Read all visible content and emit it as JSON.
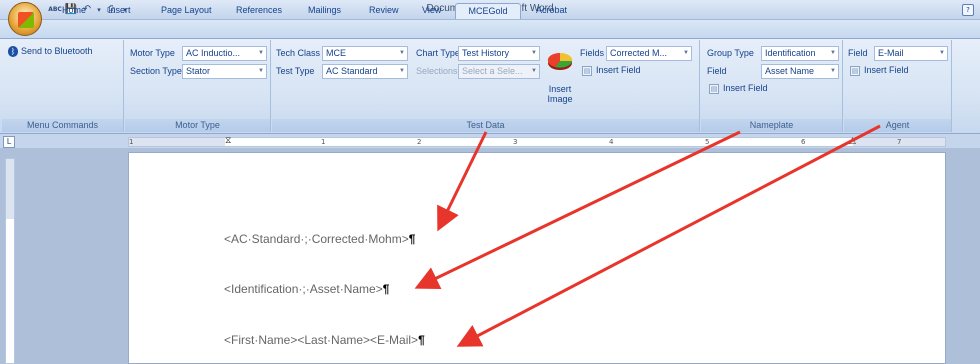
{
  "titlebar": {
    "title": "Document2 - Microsoft Word",
    "help": "?"
  },
  "qat": {
    "spell": "ABC",
    "save": "💾",
    "undo": "↶",
    "dropdown": "▾",
    "print": "⎙"
  },
  "tabs": [
    {
      "label": "Home"
    },
    {
      "label": "Insert"
    },
    {
      "label": "Page Layout"
    },
    {
      "label": "References"
    },
    {
      "label": "Mailings"
    },
    {
      "label": "Review"
    },
    {
      "label": "View"
    },
    {
      "label": "MCEGold"
    },
    {
      "label": "Acrobat"
    }
  ],
  "ribbon": {
    "menu_commands": {
      "send_bluetooth": "Send to Bluetooth",
      "label": "Menu Commands"
    },
    "motor_type": {
      "motor_type_label": "Motor Type",
      "motor_type_value": "AC Inductio...",
      "section_type_label": "Section Type",
      "section_type_value": "Stator",
      "label": "Motor Type"
    },
    "test_data": {
      "tech_class_label": "Tech Class",
      "tech_class_value": "MCE",
      "test_type_label": "Test Type",
      "test_type_value": "AC Standard",
      "chart_type_label": "Chart Type",
      "chart_type_value": "Test History",
      "selections_label": "Selections",
      "selections_value": "Select a Sele...",
      "insert_image": "Insert Image",
      "fields_label": "Fields",
      "fields_value": "Corrected M...",
      "insert_field": "Insert Field",
      "label": "Test Data"
    },
    "nameplate": {
      "group_type_label": "Group Type",
      "group_type_value": "Identification",
      "field_label": "Field",
      "field_value": "Asset Name",
      "insert_field": "Insert Field",
      "label": "Nameplate"
    },
    "agent": {
      "field_label": "Field",
      "field_value": "E-Mail",
      "insert_field": "Insert Field",
      "label": "Agent"
    }
  },
  "ruler": {
    "nums": [
      "1",
      "1",
      "2",
      "3",
      "4",
      "5",
      "6",
      "7"
    ]
  },
  "document": {
    "lines": [
      {
        "text": "<AC·Standard·;·Corrected·Mohm>",
        "pilcrow": "¶"
      },
      {
        "text": "<Identification·;·Asset·Name>",
        "pilcrow": "¶"
      },
      {
        "text": "<First·Name><Last·Name><E-Mail>",
        "pilcrow": "¶"
      }
    ]
  },
  "colors": {
    "arrow": "#e8352b",
    "ribbon_text": "#15428b"
  }
}
